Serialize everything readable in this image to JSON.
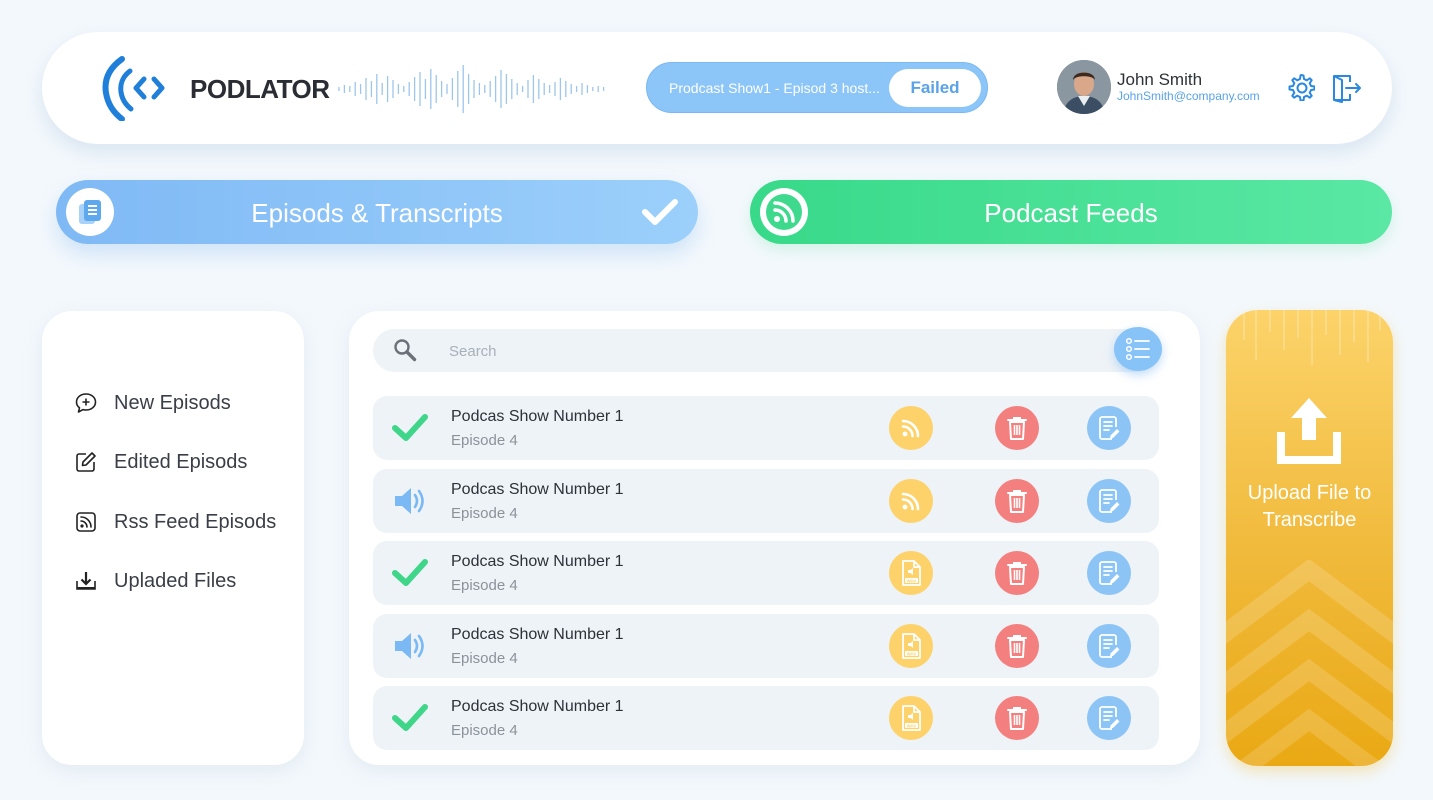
{
  "header": {
    "brand": "PODLATOR",
    "status_text": "Prodcast Show1 - Episod 3 host...",
    "status_badge": "Failed",
    "user_name": "John Smith",
    "user_email": "JohnSmith@company.com"
  },
  "tabs": [
    {
      "label": "Episods & Transcripts",
      "active": true
    },
    {
      "label": "Podcast Feeds",
      "active": false
    }
  ],
  "sidebar": {
    "items": [
      {
        "label": "New Episods",
        "icon": "chat-plus-icon"
      },
      {
        "label": "Edited Episods",
        "icon": "edit-icon"
      },
      {
        "label": "Rss Feed Episods",
        "icon": "rss-icon"
      },
      {
        "label": "Upladed Files",
        "icon": "download-icon"
      }
    ]
  },
  "search": {
    "placeholder": "Search",
    "value": ""
  },
  "episodes": [
    {
      "title": "Podcas Show Number 1",
      "subtitle": "Episode 4",
      "status": "check-icon",
      "source": "rss-icon"
    },
    {
      "title": "Podcas Show Number 1",
      "subtitle": "Episode 4",
      "status": "speaker-icon",
      "source": "rss-icon"
    },
    {
      "title": "Podcas Show Number 1",
      "subtitle": "Episode 4",
      "status": "check-icon",
      "source": "wav-file-icon"
    },
    {
      "title": "Podcas Show Number 1",
      "subtitle": "Episode 4",
      "status": "speaker-icon",
      "source": "wav-file-icon"
    },
    {
      "title": "Podcas Show Number 1",
      "subtitle": "Episode 4",
      "status": "check-icon",
      "source": "wav-file-icon"
    }
  ],
  "upload": {
    "line1": "Upload File to",
    "line2": "Transcribe"
  },
  "colors": {
    "blue": "#7fb9f5",
    "green": "#38d989",
    "yellow": "#fdd26a",
    "red": "#f3807e",
    "accent": "#5aa3e8"
  }
}
